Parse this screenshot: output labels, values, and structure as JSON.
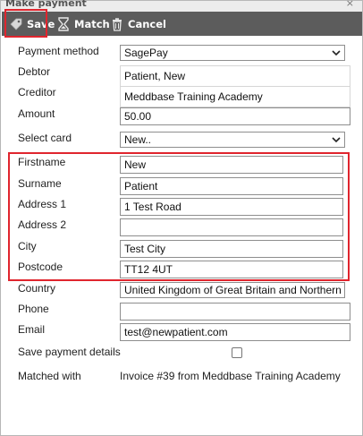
{
  "window": {
    "title": "Make payment",
    "close_glyph": "×"
  },
  "toolbar": {
    "save_label": "Save",
    "match_label": "Match",
    "cancel_label": "Cancel",
    "save_icon": "tag-icon",
    "match_icon": "hourglass-icon",
    "cancel_icon": "trash-icon"
  },
  "form": {
    "payment_method": {
      "label": "Payment method",
      "value": "SagePay"
    },
    "debtor": {
      "label": "Debtor",
      "value": "Patient, New"
    },
    "creditor": {
      "label": "Creditor",
      "value": "Meddbase Training Academy"
    },
    "amount": {
      "label": "Amount",
      "value": "50.00"
    },
    "select_card": {
      "label": "Select card",
      "value": "New.."
    },
    "firstname": {
      "label": "Firstname",
      "value": "New"
    },
    "surname": {
      "label": "Surname",
      "value": "Patient"
    },
    "address1": {
      "label": "Address 1",
      "value": "1 Test Road"
    },
    "address2": {
      "label": "Address 2",
      "value": ""
    },
    "city": {
      "label": "City",
      "value": "Test City"
    },
    "postcode": {
      "label": "Postcode",
      "value": "TT12 4UT"
    },
    "country": {
      "label": "Country",
      "value": "United Kingdom of Great Britain and Northern I"
    },
    "phone": {
      "label": "Phone",
      "value": ""
    },
    "email": {
      "label": "Email",
      "value": "test@newpatient.com"
    },
    "save_payment_details": {
      "label": "Save payment details",
      "checked": false
    },
    "matched_with": {
      "label": "Matched with",
      "value": "Invoice #39 from Meddbase Training Academy"
    }
  },
  "colors": {
    "toolbar_bg": "#5c5c5c",
    "highlight": "#e0252e"
  }
}
